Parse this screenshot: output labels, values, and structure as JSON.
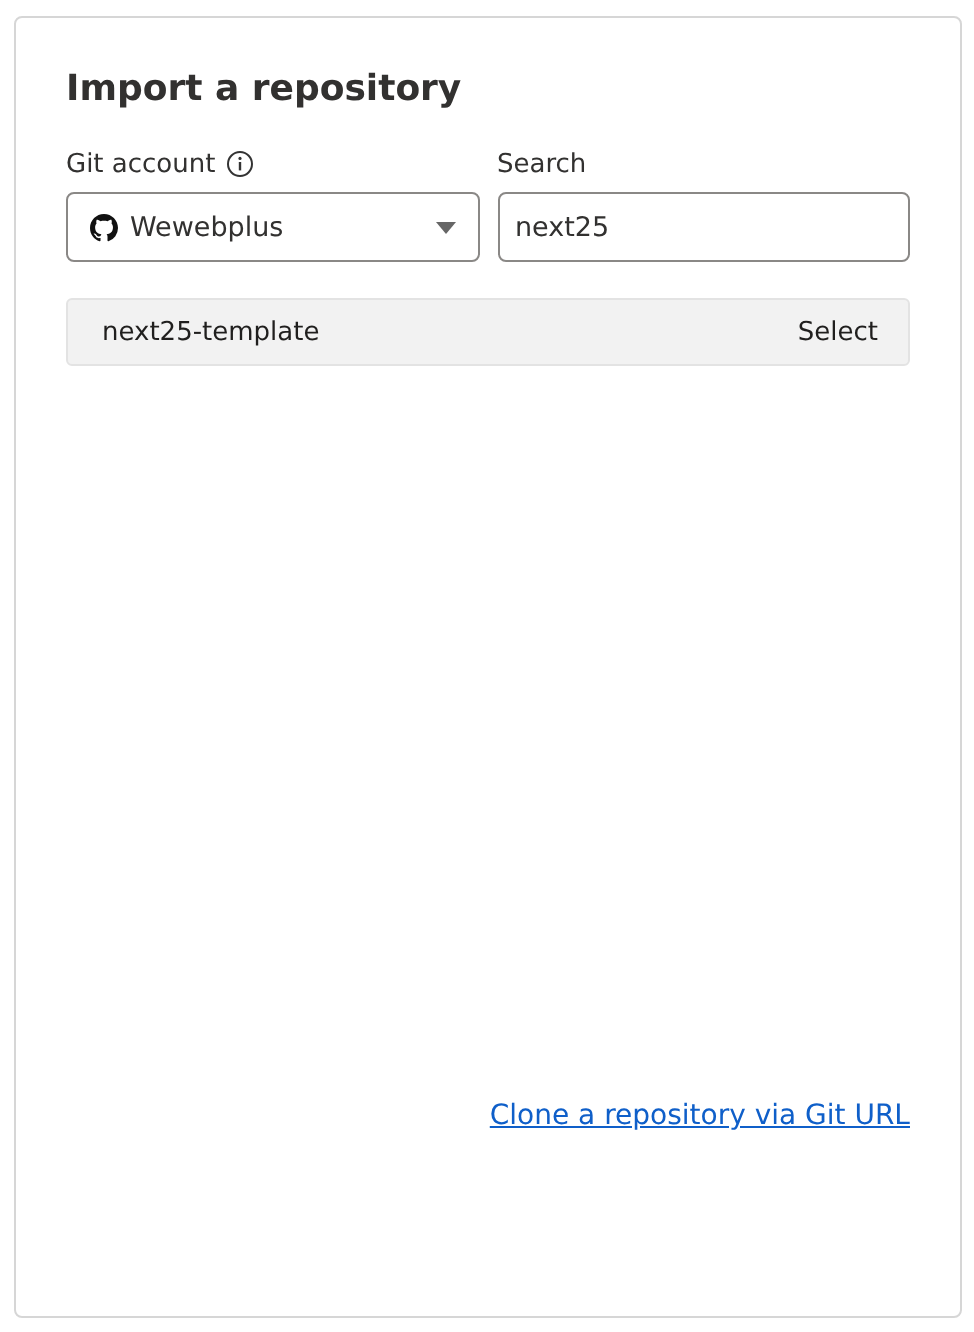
{
  "title": "Import a repository",
  "git_account": {
    "label": "Git account",
    "value": "Wewebplus"
  },
  "search": {
    "label": "Search",
    "value": "next25"
  },
  "repositories": [
    {
      "name": "next25-template",
      "action": "Select"
    }
  ],
  "clone_link": "Clone a repository via Git URL"
}
